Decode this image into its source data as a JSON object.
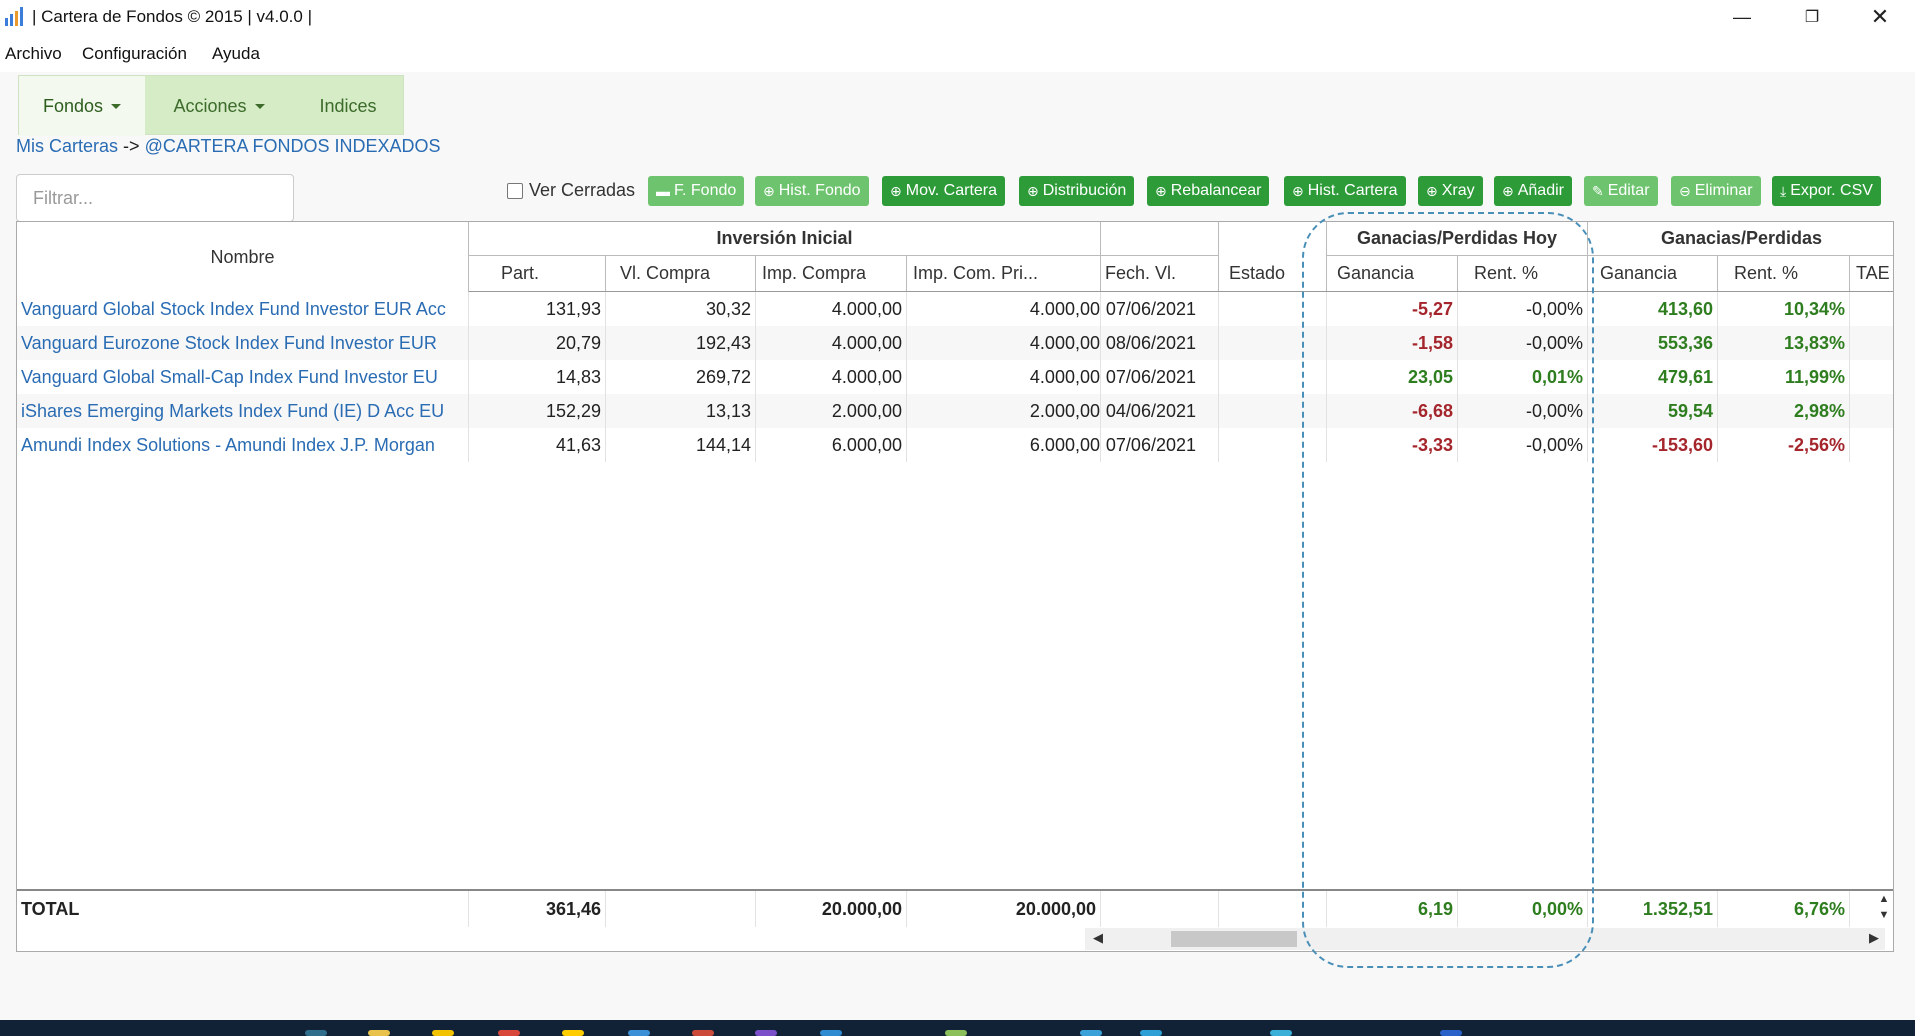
{
  "window": {
    "title": "| Cartera de Fondos © 2015 | v4.0.0 |"
  },
  "menu": [
    "Archivo",
    "Configuración",
    "Ayuda"
  ],
  "tabs": [
    {
      "label": "Fondos"
    },
    {
      "label": "Acciones"
    },
    {
      "label": "Indices"
    }
  ],
  "breadcrumb": {
    "root": "Mis Carteras",
    "separator": "->",
    "current": "@CARTERA FONDOS INDEXADOS"
  },
  "filter": {
    "placeholder": "Filtrar...",
    "value": ""
  },
  "show_closed": {
    "label": "Ver Cerradas",
    "checked": false
  },
  "toolbar": [
    {
      "label": "F. Fondo",
      "icon": "card-icon"
    },
    {
      "label": "Hist. Fondo",
      "icon": "zoom-icon"
    },
    {
      "label": "Mov. Cartera",
      "icon": "zoom-icon"
    },
    {
      "label": "Distribución",
      "icon": "zoom-icon"
    },
    {
      "label": "Rebalancear",
      "icon": "zoom-icon"
    },
    {
      "label": "Hist. Cartera",
      "icon": "zoom-icon"
    },
    {
      "label": "Xray",
      "icon": "zoom-icon"
    },
    {
      "label": "Añadir",
      "icon": "plus-circle-icon"
    },
    {
      "label": "Editar",
      "icon": "edit-icon"
    },
    {
      "label": "Eliminar",
      "icon": "minus-circle-icon"
    },
    {
      "label": "Expor. CSV",
      "icon": "download-icon"
    }
  ],
  "table": {
    "groups": {
      "inversion": "Inversión Inicial",
      "hoy": "Ganacias/Perdidas Hoy",
      "total": "Ganacias/Perdidas"
    },
    "columns": [
      "Nombre",
      "Part.",
      "Vl. Compra",
      "Imp. Compra",
      "Imp. Com. Pri...",
      "Fech. Vl.",
      "Estado",
      "Ganancia",
      "Rent. %",
      "Ganancia",
      "Rent. %",
      "TAE"
    ],
    "rows": [
      {
        "nombre": "Vanguard Global Stock Index Fund Investor EUR Acc",
        "part": "131,93",
        "vl_compra": "30,32",
        "imp_compra": "4.000,00",
        "imp_com_pri": "4.000,00",
        "fech_vl": "07/06/2021",
        "estado": "",
        "hoy_ganancia": "-5,27",
        "hoy_rent": "-0,00%",
        "ganancia": "413,60",
        "rent": "10,34%",
        "tae": ""
      },
      {
        "nombre": "Vanguard Eurozone Stock Index Fund Investor EUR",
        "part": "20,79",
        "vl_compra": "192,43",
        "imp_compra": "4.000,00",
        "imp_com_pri": "4.000,00",
        "fech_vl": "08/06/2021",
        "estado": "",
        "hoy_ganancia": "-1,58",
        "hoy_rent": "-0,00%",
        "ganancia": "553,36",
        "rent": "13,83%",
        "tae": ""
      },
      {
        "nombre": "Vanguard Global Small-Cap Index Fund Investor EU",
        "part": "14,83",
        "vl_compra": "269,72",
        "imp_compra": "4.000,00",
        "imp_com_pri": "4.000,00",
        "fech_vl": "07/06/2021",
        "estado": "",
        "hoy_ganancia": "23,05",
        "hoy_rent": "0,01%",
        "ganancia": "479,61",
        "rent": "11,99%",
        "tae": ""
      },
      {
        "nombre": "iShares Emerging Markets Index Fund (IE) D Acc EU",
        "part": "152,29",
        "vl_compra": "13,13",
        "imp_compra": "2.000,00",
        "imp_com_pri": "2.000,00",
        "fech_vl": "04/06/2021",
        "estado": "",
        "hoy_ganancia": "-6,68",
        "hoy_rent": "-0,00%",
        "ganancia": "59,54",
        "rent": "2,98%",
        "tae": ""
      },
      {
        "nombre": "Amundi Index Solutions - Amundi Index J.P. Morgan",
        "part": "41,63",
        "vl_compra": "144,14",
        "imp_compra": "6.000,00",
        "imp_com_pri": "6.000,00",
        "fech_vl": "07/06/2021",
        "estado": "",
        "hoy_ganancia": "-3,33",
        "hoy_rent": "-0,00%",
        "ganancia": "-153,60",
        "rent": "-2,56%",
        "tae": ""
      }
    ],
    "total": {
      "label": "TOTAL",
      "part": "361,46",
      "imp_compra": "20.000,00",
      "imp_com_pri": "20.000,00",
      "hoy_ganancia": "6,19",
      "hoy_rent": "0,00%",
      "ganancia": "1.352,51",
      "rent": "6,76%"
    }
  },
  "colors": {
    "positive": "#2e7d1f",
    "negative": "#a4262c",
    "link": "#2a6cb3",
    "btn_green": "#2e9b39",
    "tab_bg": "#d5ecc7"
  }
}
